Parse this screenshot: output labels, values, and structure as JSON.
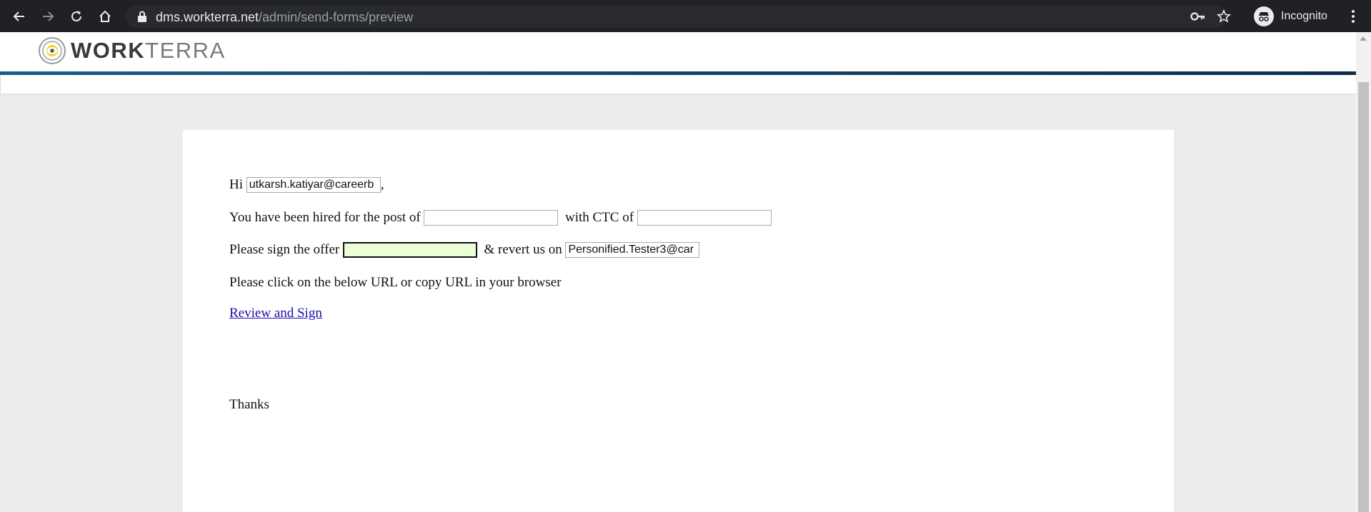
{
  "browser": {
    "url_host": "dms.workterra.net",
    "url_path": "/admin/send-forms/preview",
    "profile_label": "Incognito"
  },
  "header": {
    "brand_bold": "WORK",
    "brand_light": "TERRA"
  },
  "letter": {
    "greeting_prefix": "Hi",
    "recipient_email": "utkarsh.katiyar@careerb",
    "greeting_suffix": ",",
    "hired_text": "You have been hired for the post of",
    "post_value": "",
    "ctc_text": "with CTC of",
    "ctc_value": "",
    "sign_text": "Please sign the offer",
    "sign_value": "",
    "revert_text": "& revert us on",
    "revert_email": "Personified.Tester3@car",
    "url_instruction": "Please click on the below URL or copy URL in your browser",
    "review_link_label": "Review and Sign",
    "closing": "Thanks"
  },
  "colors": {
    "browser_bar": "#202124",
    "page_background": "#ececec",
    "header_rule": "#14466d",
    "link": "#1a0dab",
    "active_field": "#eaffd6"
  }
}
